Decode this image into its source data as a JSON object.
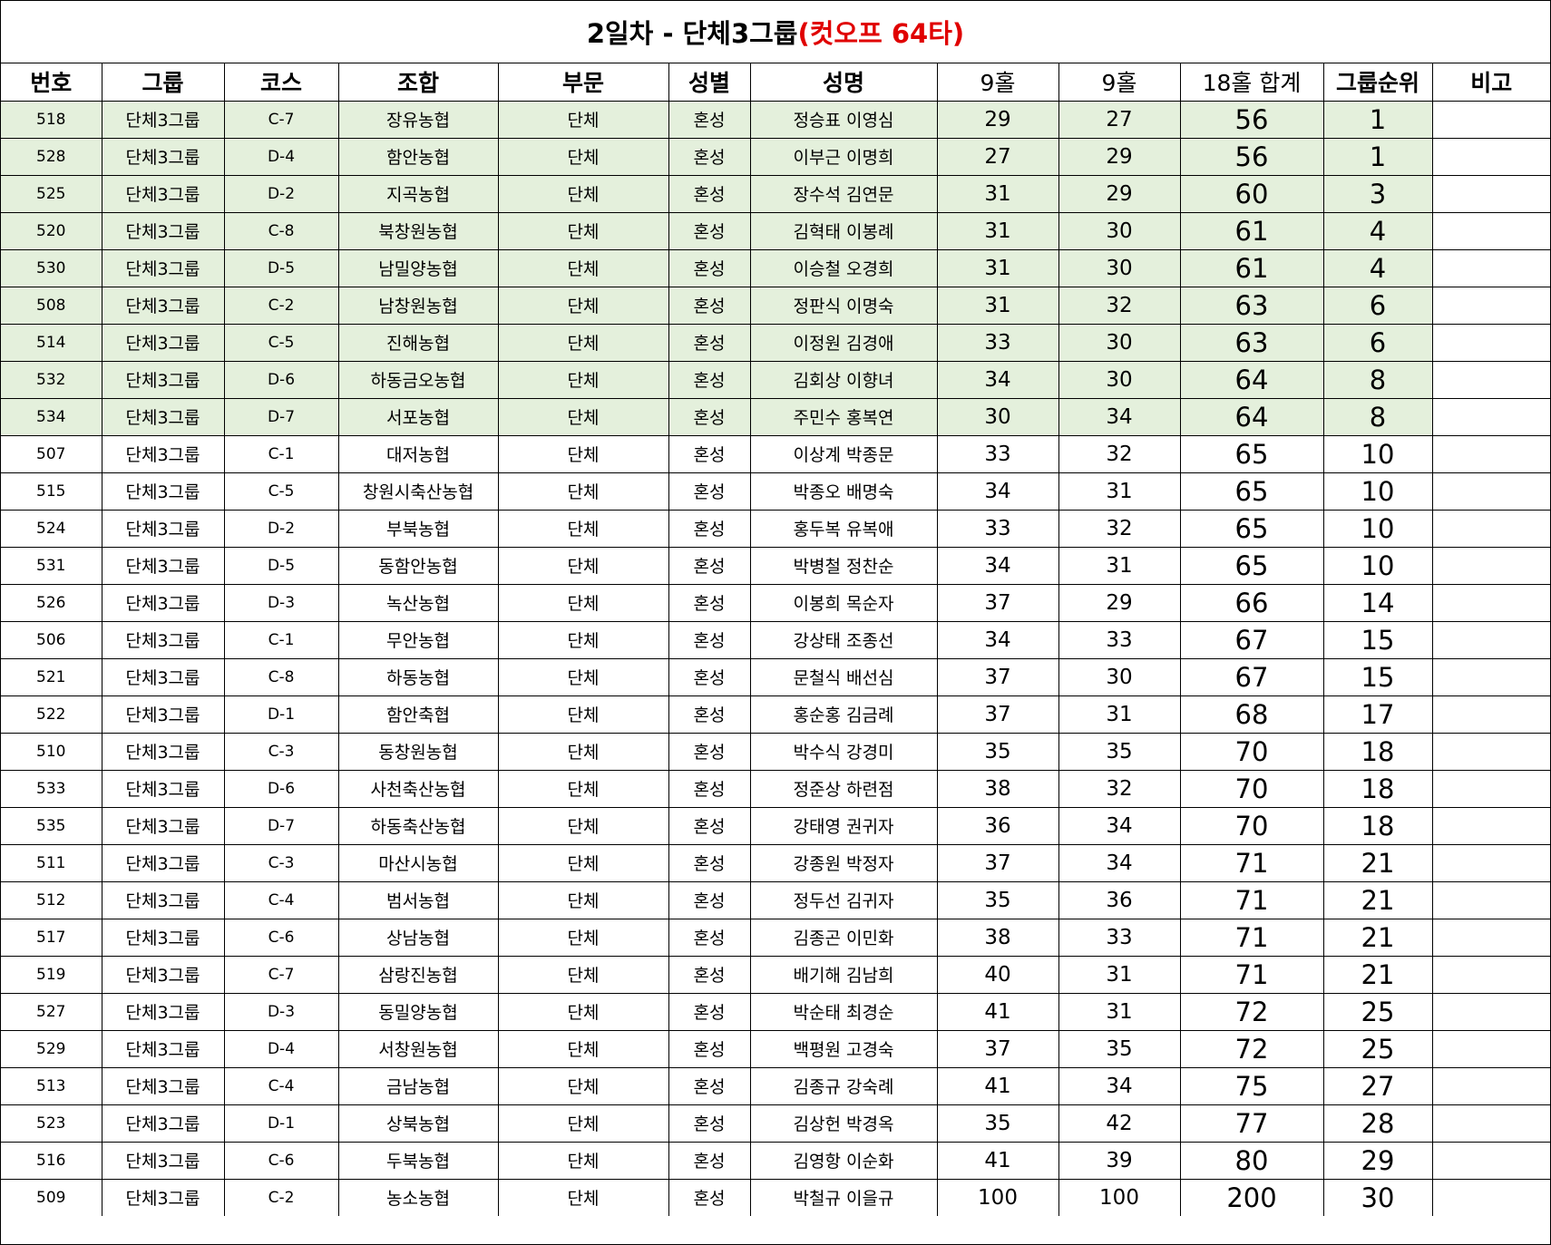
{
  "title": {
    "main": "2일차 - 단체3그룹",
    "cutoff": "(컷오프 64타)"
  },
  "headers": [
    "번호",
    "그룹",
    "코스",
    "조합",
    "부문",
    "성별",
    "성명",
    "9홀",
    "9홀",
    "18홀 합계",
    "그룹순위",
    "비고"
  ],
  "highlight_color": "#e4f0dc",
  "rows": [
    {
      "no": "518",
      "group": "단체3그룹",
      "course": "C-7",
      "assoc": "장유농협",
      "division": "단체",
      "gender": "혼성",
      "names": "정승표 이영심",
      "front": "29",
      "back": "27",
      "total": "56",
      "rank": "1",
      "note": "",
      "highlight": true
    },
    {
      "no": "528",
      "group": "단체3그룹",
      "course": "D-4",
      "assoc": "함안농협",
      "division": "단체",
      "gender": "혼성",
      "names": "이부근 이명희",
      "front": "27",
      "back": "29",
      "total": "56",
      "rank": "1",
      "note": "",
      "highlight": true
    },
    {
      "no": "525",
      "group": "단체3그룹",
      "course": "D-2",
      "assoc": "지곡농협",
      "division": "단체",
      "gender": "혼성",
      "names": "장수석 김연문",
      "front": "31",
      "back": "29",
      "total": "60",
      "rank": "3",
      "note": "",
      "highlight": true
    },
    {
      "no": "520",
      "group": "단체3그룹",
      "course": "C-8",
      "assoc": "북창원농협",
      "division": "단체",
      "gender": "혼성",
      "names": "김혁태 이봉례",
      "front": "31",
      "back": "30",
      "total": "61",
      "rank": "4",
      "note": "",
      "highlight": true
    },
    {
      "no": "530",
      "group": "단체3그룹",
      "course": "D-5",
      "assoc": "남밀양농협",
      "division": "단체",
      "gender": "혼성",
      "names": "이승철 오경희",
      "front": "31",
      "back": "30",
      "total": "61",
      "rank": "4",
      "note": "",
      "highlight": true
    },
    {
      "no": "508",
      "group": "단체3그룹",
      "course": "C-2",
      "assoc": "남창원농협",
      "division": "단체",
      "gender": "혼성",
      "names": "정판식 이명숙",
      "front": "31",
      "back": "32",
      "total": "63",
      "rank": "6",
      "note": "",
      "highlight": true
    },
    {
      "no": "514",
      "group": "단체3그룹",
      "course": "C-5",
      "assoc": "진해농협",
      "division": "단체",
      "gender": "혼성",
      "names": "이정원 김경애",
      "front": "33",
      "back": "30",
      "total": "63",
      "rank": "6",
      "note": "",
      "highlight": true
    },
    {
      "no": "532",
      "group": "단체3그룹",
      "course": "D-6",
      "assoc": "하동금오농협",
      "division": "단체",
      "gender": "혼성",
      "names": "김회상 이향녀",
      "front": "34",
      "back": "30",
      "total": "64",
      "rank": "8",
      "note": "",
      "highlight": true
    },
    {
      "no": "534",
      "group": "단체3그룹",
      "course": "D-7",
      "assoc": "서포농협",
      "division": "단체",
      "gender": "혼성",
      "names": "주민수 홍복연",
      "front": "30",
      "back": "34",
      "total": "64",
      "rank": "8",
      "note": "",
      "highlight": true
    },
    {
      "no": "507",
      "group": "단체3그룹",
      "course": "C-1",
      "assoc": "대저농협",
      "division": "단체",
      "gender": "혼성",
      "names": "이상계 박종문",
      "front": "33",
      "back": "32",
      "total": "65",
      "rank": "10",
      "note": "",
      "highlight": false
    },
    {
      "no": "515",
      "group": "단체3그룹",
      "course": "C-5",
      "assoc": "창원시축산농협",
      "division": "단체",
      "gender": "혼성",
      "names": "박종오 배명숙",
      "front": "34",
      "back": "31",
      "total": "65",
      "rank": "10",
      "note": "",
      "highlight": false
    },
    {
      "no": "524",
      "group": "단체3그룹",
      "course": "D-2",
      "assoc": "부북농협",
      "division": "단체",
      "gender": "혼성",
      "names": "홍두복 유복애",
      "front": "33",
      "back": "32",
      "total": "65",
      "rank": "10",
      "note": "",
      "highlight": false
    },
    {
      "no": "531",
      "group": "단체3그룹",
      "course": "D-5",
      "assoc": "동함안농협",
      "division": "단체",
      "gender": "혼성",
      "names": "박병철 정찬순",
      "front": "34",
      "back": "31",
      "total": "65",
      "rank": "10",
      "note": "",
      "highlight": false
    },
    {
      "no": "526",
      "group": "단체3그룹",
      "course": "D-3",
      "assoc": "녹산농협",
      "division": "단체",
      "gender": "혼성",
      "names": "이봉희 목순자",
      "front": "37",
      "back": "29",
      "total": "66",
      "rank": "14",
      "note": "",
      "highlight": false
    },
    {
      "no": "506",
      "group": "단체3그룹",
      "course": "C-1",
      "assoc": "무안농협",
      "division": "단체",
      "gender": "혼성",
      "names": "강상태 조종선",
      "front": "34",
      "back": "33",
      "total": "67",
      "rank": "15",
      "note": "",
      "highlight": false
    },
    {
      "no": "521",
      "group": "단체3그룹",
      "course": "C-8",
      "assoc": "하동농협",
      "division": "단체",
      "gender": "혼성",
      "names": "문철식 배선심",
      "front": "37",
      "back": "30",
      "total": "67",
      "rank": "15",
      "note": "",
      "highlight": false
    },
    {
      "no": "522",
      "group": "단체3그룹",
      "course": "D-1",
      "assoc": "함안축협",
      "division": "단체",
      "gender": "혼성",
      "names": "홍순홍 김금례",
      "front": "37",
      "back": "31",
      "total": "68",
      "rank": "17",
      "note": "",
      "highlight": false
    },
    {
      "no": "510",
      "group": "단체3그룹",
      "course": "C-3",
      "assoc": "동창원농협",
      "division": "단체",
      "gender": "혼성",
      "names": "박수식 강경미",
      "front": "35",
      "back": "35",
      "total": "70",
      "rank": "18",
      "note": "",
      "highlight": false
    },
    {
      "no": "533",
      "group": "단체3그룹",
      "course": "D-6",
      "assoc": "사천축산농협",
      "division": "단체",
      "gender": "혼성",
      "names": "정준상 하련점",
      "front": "38",
      "back": "32",
      "total": "70",
      "rank": "18",
      "note": "",
      "highlight": false
    },
    {
      "no": "535",
      "group": "단체3그룹",
      "course": "D-7",
      "assoc": "하동축산농협",
      "division": "단체",
      "gender": "혼성",
      "names": "강태영 권귀자",
      "front": "36",
      "back": "34",
      "total": "70",
      "rank": "18",
      "note": "",
      "highlight": false
    },
    {
      "no": "511",
      "group": "단체3그룹",
      "course": "C-3",
      "assoc": "마산시농협",
      "division": "단체",
      "gender": "혼성",
      "names": "강종원 박정자",
      "front": "37",
      "back": "34",
      "total": "71",
      "rank": "21",
      "note": "",
      "highlight": false
    },
    {
      "no": "512",
      "group": "단체3그룹",
      "course": "C-4",
      "assoc": "범서농협",
      "division": "단체",
      "gender": "혼성",
      "names": "정두선 김귀자",
      "front": "35",
      "back": "36",
      "total": "71",
      "rank": "21",
      "note": "",
      "highlight": false
    },
    {
      "no": "517",
      "group": "단체3그룹",
      "course": "C-6",
      "assoc": "상남농협",
      "division": "단체",
      "gender": "혼성",
      "names": "김종곤 이민화",
      "front": "38",
      "back": "33",
      "total": "71",
      "rank": "21",
      "note": "",
      "highlight": false
    },
    {
      "no": "519",
      "group": "단체3그룹",
      "course": "C-7",
      "assoc": "삼랑진농협",
      "division": "단체",
      "gender": "혼성",
      "names": "배기해 김남희",
      "front": "40",
      "back": "31",
      "total": "71",
      "rank": "21",
      "note": "",
      "highlight": false
    },
    {
      "no": "527",
      "group": "단체3그룹",
      "course": "D-3",
      "assoc": "동밀양농협",
      "division": "단체",
      "gender": "혼성",
      "names": "박순태 최경순",
      "front": "41",
      "back": "31",
      "total": "72",
      "rank": "25",
      "note": "",
      "highlight": false
    },
    {
      "no": "529",
      "group": "단체3그룹",
      "course": "D-4",
      "assoc": "서창원농협",
      "division": "단체",
      "gender": "혼성",
      "names": "백평원 고경숙",
      "front": "37",
      "back": "35",
      "total": "72",
      "rank": "25",
      "note": "",
      "highlight": false
    },
    {
      "no": "513",
      "group": "단체3그룹",
      "course": "C-4",
      "assoc": "금남농협",
      "division": "단체",
      "gender": "혼성",
      "names": "김종규 강숙례",
      "front": "41",
      "back": "34",
      "total": "75",
      "rank": "27",
      "note": "",
      "highlight": false
    },
    {
      "no": "523",
      "group": "단체3그룹",
      "course": "D-1",
      "assoc": "상북농협",
      "division": "단체",
      "gender": "혼성",
      "names": "김상헌 박경옥",
      "front": "35",
      "back": "42",
      "total": "77",
      "rank": "28",
      "note": "",
      "highlight": false
    },
    {
      "no": "516",
      "group": "단체3그룹",
      "course": "C-6",
      "assoc": "두북농협",
      "division": "단체",
      "gender": "혼성",
      "names": "김영항 이순화",
      "front": "41",
      "back": "39",
      "total": "80",
      "rank": "29",
      "note": "",
      "highlight": false
    },
    {
      "no": "509",
      "group": "단체3그룹",
      "course": "C-2",
      "assoc": "농소농협",
      "division": "단체",
      "gender": "혼성",
      "names": "박철규 이을규",
      "front": "100",
      "back": "100",
      "total": "200",
      "rank": "30",
      "note": "",
      "highlight": false
    }
  ]
}
